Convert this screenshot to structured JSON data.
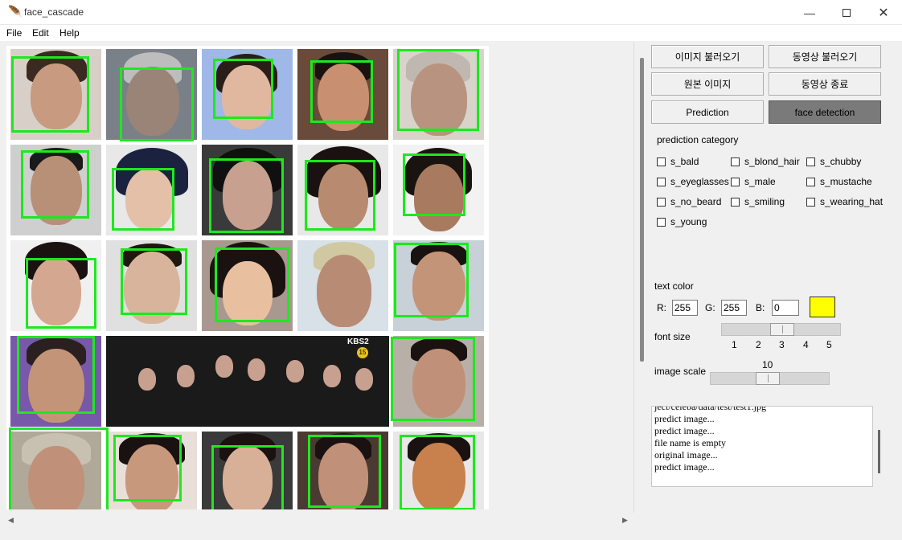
{
  "window": {
    "title": "face_cascade",
    "minimize_glyph": "—",
    "close_glyph": "✕"
  },
  "menu": {
    "file": "File",
    "edit": "Edit",
    "help": "Help"
  },
  "buttons": {
    "load_image": "이미지 불러오기",
    "load_video": "동영상 불러오기",
    "original_image": "원본 이미지",
    "stop_video": "동영상 종료",
    "prediction": "Prediction",
    "face_detection": "face detection"
  },
  "prediction_category": {
    "label": "prediction category",
    "items": [
      {
        "label": "s_bald",
        "checked": false
      },
      {
        "label": "s_blond_hair",
        "checked": false
      },
      {
        "label": "s_chubby",
        "checked": false
      },
      {
        "label": "s_eyeglasses",
        "checked": false
      },
      {
        "label": "s_male",
        "checked": false
      },
      {
        "label": "s_mustache",
        "checked": false
      },
      {
        "label": "s_no_beard",
        "checked": false
      },
      {
        "label": "s_smiling",
        "checked": false
      },
      {
        "label": "s_wearing_hat",
        "checked": false
      },
      {
        "label": "s_young",
        "checked": false
      }
    ]
  },
  "text_color": {
    "label": "text color",
    "r_label": "R:",
    "g_label": "G:",
    "b_label": "B:",
    "r": "255",
    "g": "255",
    "b": "0",
    "swatch_color": "#ffff00"
  },
  "font_size": {
    "label": "font size",
    "ticks": [
      "1",
      "2",
      "3",
      "4",
      "5"
    ],
    "value": 3
  },
  "image_scale": {
    "label": "image scale",
    "value": "10"
  },
  "log": {
    "lines": [
      "ject/celeba/data/test/test1.jpg",
      "predict image...",
      "predict image...",
      "file name is empty",
      "original image...",
      "predict image..."
    ]
  },
  "scroll": {
    "left_arrow": "◀",
    "right_arrow": "▶"
  },
  "colors": {
    "detection_box": "#1ee81e",
    "active_button": "#7a7a7a"
  },
  "broadcast_logo": {
    "text": "KBS2",
    "channel": "15"
  }
}
